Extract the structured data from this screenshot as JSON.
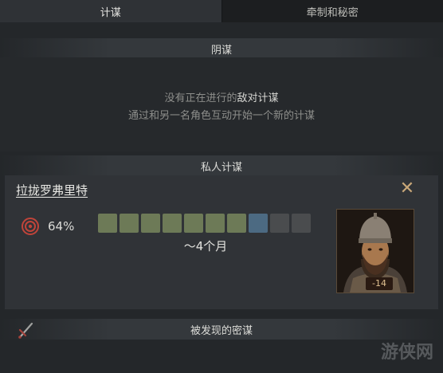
{
  "tabs": [
    {
      "label": "计谋",
      "active": true
    },
    {
      "label": "牵制和秘密",
      "active": false
    }
  ],
  "hostile": {
    "header": "阴谋",
    "line1_prefix": "没有正在进行的",
    "line1_highlight": "敌对计谋",
    "line2": "通过和另一名角色互动开始一个新的计谋"
  },
  "personal": {
    "header": "私人计谋",
    "scheme": {
      "title": "拉拢罗弗里特",
      "success_chance": "64%",
      "progress": {
        "done": 7,
        "current": 1,
        "empty": 2,
        "total": 10
      },
      "time_remaining": "～4个月",
      "portrait_badge": "-14"
    }
  },
  "discovered": {
    "header": "被发现的密谋"
  },
  "watermark": "游侠网",
  "colors": {
    "progress_done": "#6d7a57",
    "progress_current": "#4c6a82",
    "progress_empty": "#4a4c4e",
    "close_icon": "#c8a778",
    "target_icon": "#c0443a"
  },
  "icons": {
    "close": "close-x-icon",
    "target": "target-icon",
    "dagger": "dagger-icon"
  }
}
